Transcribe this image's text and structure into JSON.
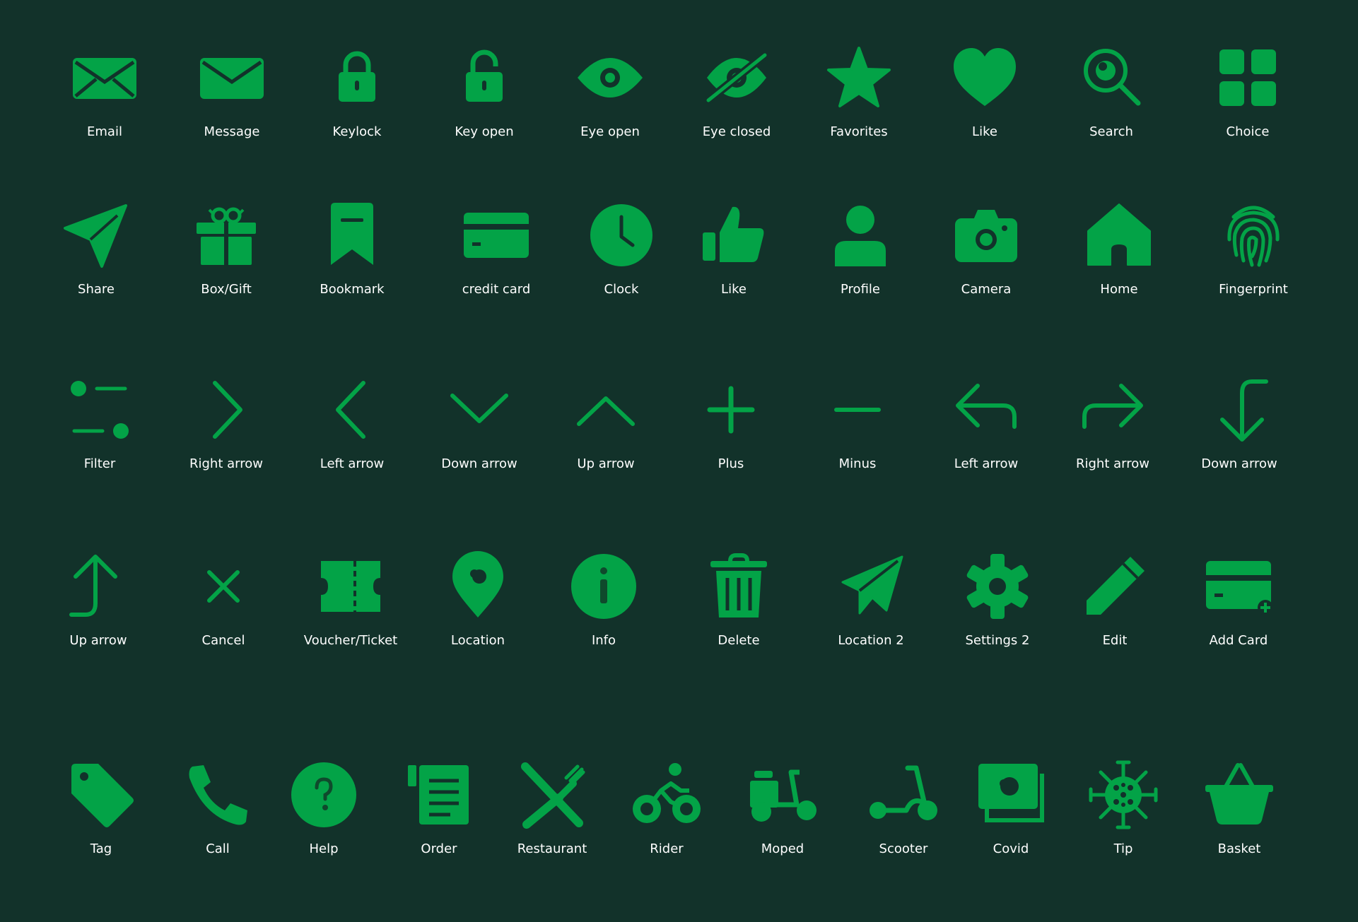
{
  "theme": {
    "background": "#12322a",
    "icon_color": "#03a347",
    "text_color": "#ffffff"
  },
  "rows": [
    [
      {
        "label": "Email",
        "icon": "envelope-open-icon"
      },
      {
        "label": "Message",
        "icon": "envelope-icon"
      },
      {
        "label": "Keylock",
        "icon": "lock-icon"
      },
      {
        "label": "Key open",
        "icon": "unlock-icon"
      },
      {
        "label": "Eye open",
        "icon": "eye-icon"
      },
      {
        "label": "Eye closed",
        "icon": "eye-slash-icon"
      },
      {
        "label": "Favorites",
        "icon": "star-icon"
      },
      {
        "label": "Like",
        "icon": "heart-icon"
      },
      {
        "label": "Search",
        "icon": "search-icon"
      },
      {
        "label": "Choice",
        "icon": "grid-icon"
      }
    ],
    [
      {
        "label": "Share",
        "icon": "send-icon"
      },
      {
        "label": "Box/Gift",
        "icon": "gift-icon"
      },
      {
        "label": "Bookmark",
        "icon": "bookmark-icon"
      },
      {
        "label": "credit card",
        "icon": "credit-card-icon"
      },
      {
        "label": "Clock",
        "icon": "clock-icon"
      },
      {
        "label": "Like",
        "icon": "thumbs-up-icon"
      },
      {
        "label": "Profile",
        "icon": "user-icon"
      },
      {
        "label": "Camera",
        "icon": "camera-icon"
      },
      {
        "label": "Home",
        "icon": "home-icon"
      },
      {
        "label": "Fingerprint",
        "icon": "fingerprint-icon"
      }
    ],
    [
      {
        "label": "Filter",
        "icon": "filter-icon"
      },
      {
        "label": "Right arrow",
        "icon": "chevron-right-icon"
      },
      {
        "label": "Left arrow",
        "icon": "chevron-left-icon"
      },
      {
        "label": "Down arrow",
        "icon": "chevron-down-icon"
      },
      {
        "label": "Up arrow",
        "icon": "chevron-up-icon"
      },
      {
        "label": "Plus",
        "icon": "plus-icon"
      },
      {
        "label": "Minus",
        "icon": "minus-icon"
      },
      {
        "label": "Left arrow",
        "icon": "corner-up-left-icon"
      },
      {
        "label": "Right arrow",
        "icon": "corner-up-right-icon"
      },
      {
        "label": "Down arrow",
        "icon": "corner-left-down-icon"
      }
    ],
    [
      {
        "label": "Up arrow",
        "icon": "corner-right-up-icon"
      },
      {
        "label": "Cancel",
        "icon": "close-icon"
      },
      {
        "label": "Voucher/Ticket",
        "icon": "ticket-icon"
      },
      {
        "label": "Location",
        "icon": "map-pin-icon"
      },
      {
        "label": "Info",
        "icon": "info-icon"
      },
      {
        "label": "Delete",
        "icon": "trash-icon"
      },
      {
        "label": "Location 2",
        "icon": "navigation-icon"
      },
      {
        "label": "Settings 2",
        "icon": "gear-icon"
      },
      {
        "label": "Edit",
        "icon": "pencil-icon"
      },
      {
        "label": "Add Card",
        "icon": "add-card-icon"
      }
    ],
    [
      {
        "label": "Tag",
        "icon": "tag-icon"
      },
      {
        "label": "Call",
        "icon": "phone-icon"
      },
      {
        "label": "Help",
        "icon": "help-icon"
      },
      {
        "label": "Order",
        "icon": "order-icon"
      },
      {
        "label": "Restaurant",
        "icon": "restaurant-icon"
      },
      {
        "label": "Rider",
        "icon": "bicycle-icon"
      },
      {
        "label": "Moped",
        "icon": "moped-icon"
      },
      {
        "label": "Scooter",
        "icon": "scooter-icon"
      },
      {
        "label": "Covid",
        "icon": "covid-icon"
      },
      {
        "label": "Tip",
        "icon": "virus-icon"
      },
      {
        "label": "Basket",
        "icon": "basket-icon"
      }
    ]
  ]
}
